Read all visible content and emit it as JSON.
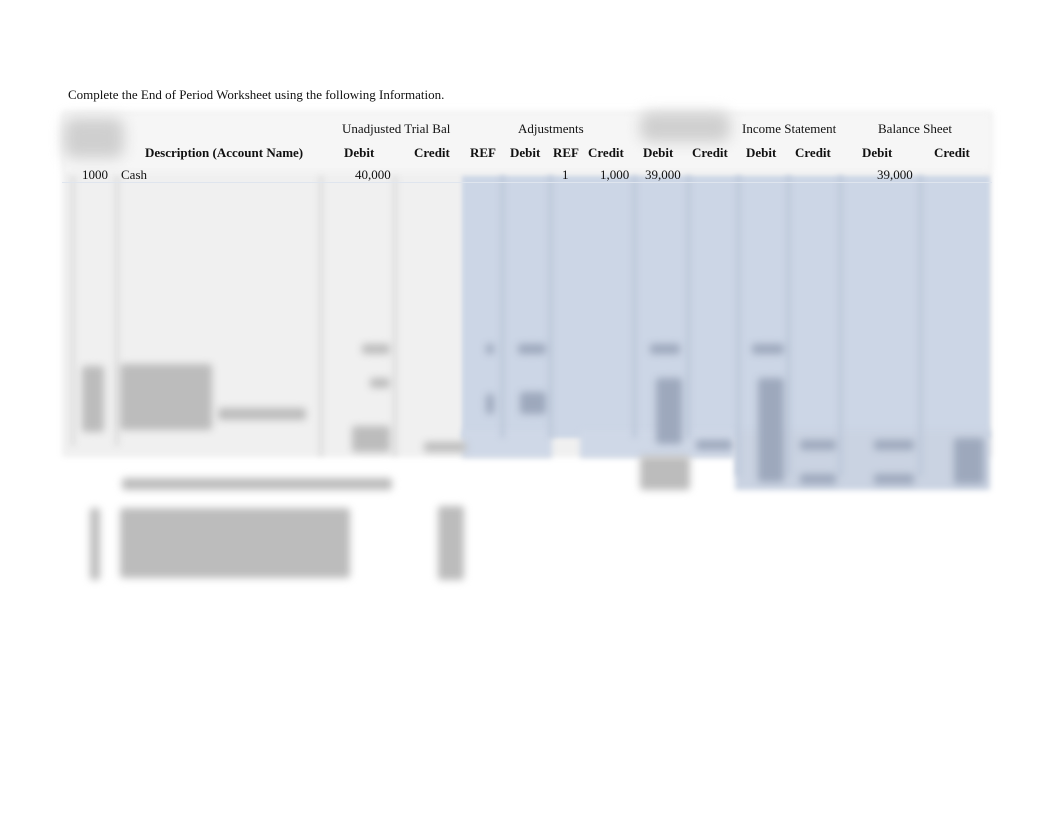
{
  "instruction": "Complete the End of Period Worksheet using the following Information.",
  "column_groups": {
    "unadjusted": "Unadjusted Trial Bal",
    "adjustments": "Adjustments",
    "income_statement": "Income Statement",
    "balance_sheet": "Balance Sheet"
  },
  "columns": {
    "description": "Description  (Account Name)",
    "utb_debit": "Debit",
    "utb_credit": "Credit",
    "adj_ref_debit": "REF",
    "adj_debit": "Debit",
    "adj_ref_credit": "REF",
    "adj_credit": "Credit",
    "atb_debit": "Debit",
    "atb_credit": "Credit",
    "is_debit": "Debit",
    "is_credit": "Credit",
    "bs_debit": "Debit",
    "bs_credit": "Credit"
  },
  "rows": [
    {
      "account_no": "1000",
      "account_name": "Cash",
      "utb_debit": "40,000",
      "adj_ref_credit": "1",
      "adj_credit": "1,000",
      "atb_debit": "39,000",
      "bs_debit": "39,000"
    }
  ],
  "colors": {
    "highlight_fill": "#ccd6e6",
    "sheet_fill": "#f0f0f0"
  }
}
